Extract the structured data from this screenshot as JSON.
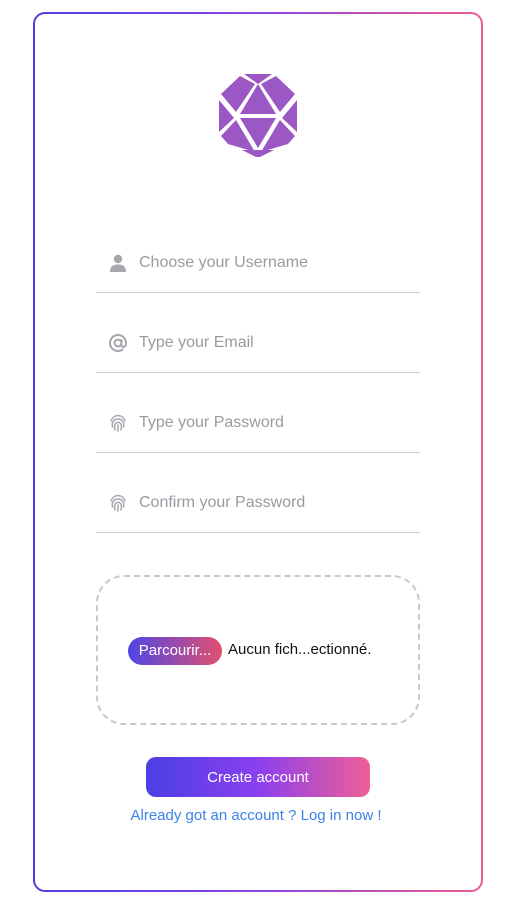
{
  "form": {
    "username_placeholder": "Choose your Username",
    "email_placeholder": "Type your Email",
    "password_placeholder": "Type your Password",
    "confirm_placeholder": "Confirm your Password"
  },
  "file_upload": {
    "browse_label": "Parcourir...",
    "status_text": "Aucun fich...ectionné."
  },
  "actions": {
    "submit_label": "Create account",
    "login_link_text": "Already got an account ? Log in now !"
  },
  "colors": {
    "logo": "#9b57c4",
    "icon_gray": "#a6a6ad",
    "link_blue": "#3b82e6",
    "gradient_start": "#4a3fe3",
    "gradient_end": "#ee5f95"
  },
  "icons": {
    "logo": "d20-dice-icon",
    "username": "user-icon",
    "email": "at-sign-icon",
    "password": "fingerprint-icon",
    "confirm": "fingerprint-icon"
  }
}
